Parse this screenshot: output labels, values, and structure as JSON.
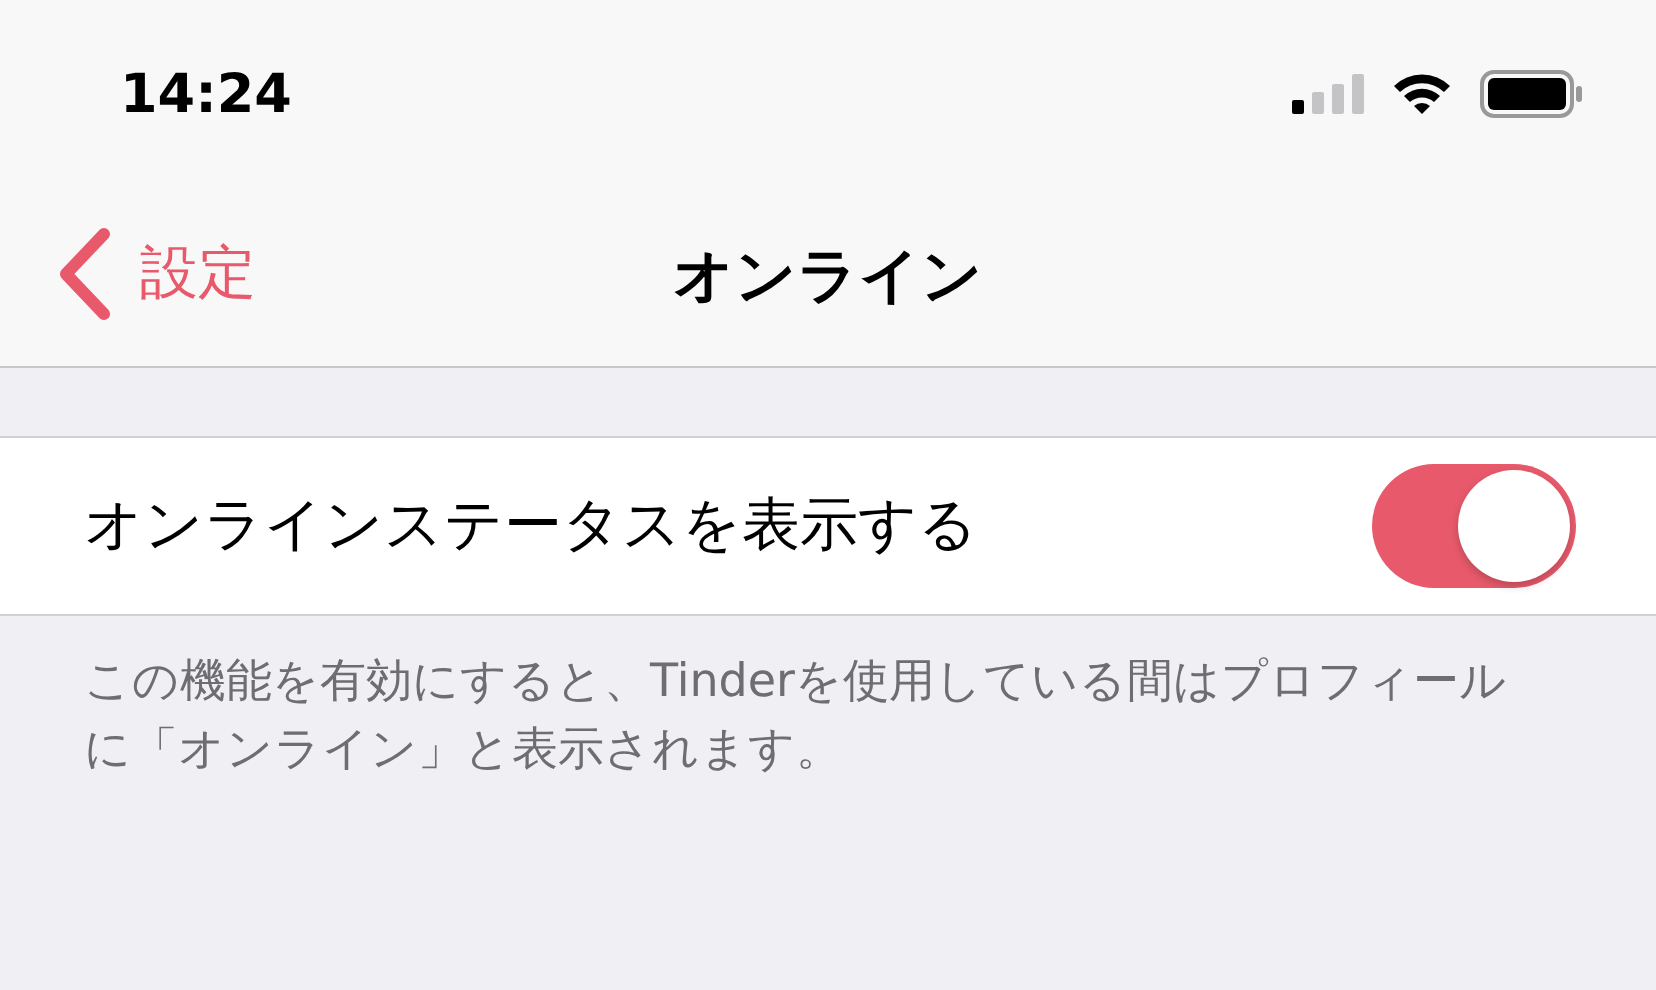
{
  "status_bar": {
    "time": "14:24"
  },
  "nav": {
    "back": "設定",
    "title": "オンライン"
  },
  "settings": [
    {
      "label": "オンラインステータスを表示する",
      "kind": "toggle",
      "on": true
    }
  ],
  "footer": "この機能を有効にすると、Tinderを使用している間はプロフィールに「オンライン」と表示されます。"
}
